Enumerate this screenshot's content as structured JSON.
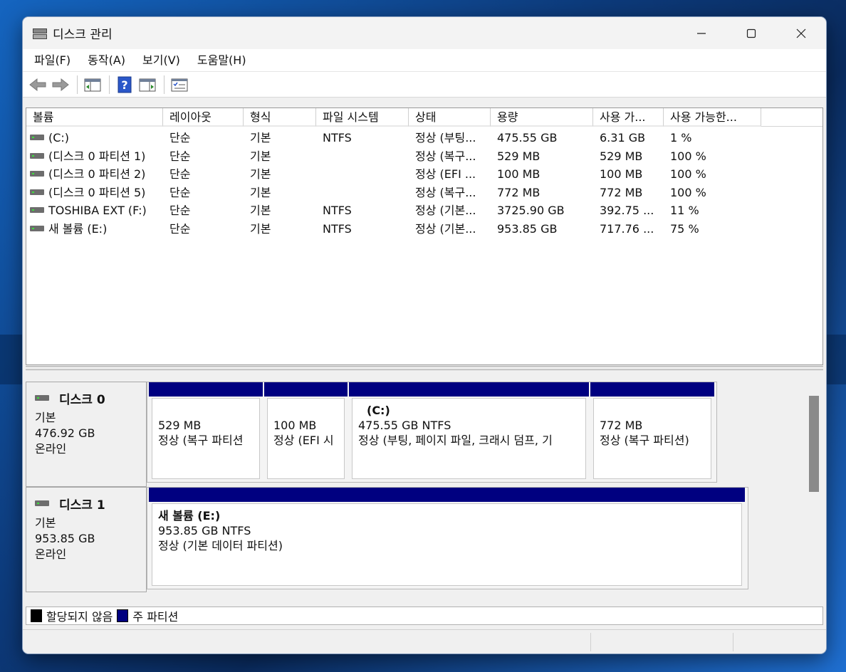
{
  "window": {
    "title": "디스크 관리"
  },
  "menu": [
    {
      "label": "파일(F)"
    },
    {
      "label": "동작(A)"
    },
    {
      "label": "보기(V)"
    },
    {
      "label": "도움말(H)"
    }
  ],
  "toolbar": {
    "icons": [
      "back-arrow-icon",
      "forward-arrow-icon",
      "show-hide-console-tree-icon",
      "help-icon",
      "show-hide-action-pane-icon",
      "properties-icon"
    ]
  },
  "volume_list": {
    "columns": [
      "볼륨",
      "레이아웃",
      "형식",
      "파일 시스템",
      "상태",
      "용량",
      "사용 가...",
      "사용 가능한..."
    ],
    "rows": [
      [
        "(C:)",
        "단순",
        "기본",
        "NTFS",
        "정상 (부팅...",
        "475.55 GB",
        "6.31 GB",
        "1 %"
      ],
      [
        "(디스크 0 파티션 1)",
        "단순",
        "기본",
        "",
        "정상 (복구...",
        "529 MB",
        "529 MB",
        "100 %"
      ],
      [
        "(디스크 0 파티션 2)",
        "단순",
        "기본",
        "",
        "정상 (EFI ...",
        "100 MB",
        "100 MB",
        "100 %"
      ],
      [
        "(디스크 0 파티션 5)",
        "단순",
        "기본",
        "",
        "정상 (복구...",
        "772 MB",
        "772 MB",
        "100 %"
      ],
      [
        "TOSHIBA EXT (F:)",
        "단순",
        "기본",
        "NTFS",
        "정상 (기본...",
        "3725.90 GB",
        "392.75 ...",
        "11 %"
      ],
      [
        "새 볼륨 (E:)",
        "단순",
        "기본",
        "NTFS",
        "정상 (기본...",
        "953.85 GB",
        "717.76 ...",
        "75 %"
      ]
    ]
  },
  "disks": [
    {
      "name": "디스크 0",
      "type": "기본",
      "size": "476.92 GB",
      "status": "온라인",
      "partitions": [
        {
          "title": "",
          "size": "529 MB",
          "status": "정상 (복구 파티션"
        },
        {
          "title": "",
          "size": "100 MB",
          "status": "정상 (EFI 시"
        },
        {
          "title": "(C:)",
          "size": "475.55 GB NTFS",
          "status": "정상 (부팅, 페이지 파일, 크래시 덤프, 기"
        },
        {
          "title": "",
          "size": "772 MB",
          "status": "정상 (복구 파티션)"
        }
      ]
    },
    {
      "name": "디스크 1",
      "type": "기본",
      "size": "953.85 GB",
      "status": "온라인",
      "partitions": [
        {
          "title": "새 볼륨  (E:)",
          "size": "953.85 GB NTFS",
          "status": "정상 (기본 데이터 파티션)"
        }
      ]
    }
  ],
  "legend": [
    {
      "label": "할당되지 않음",
      "color": "#000000"
    },
    {
      "label": "주 파티션",
      "color": "#000080"
    }
  ],
  "colors": {
    "primary_partition": "#000080",
    "unallocated": "#000000"
  }
}
